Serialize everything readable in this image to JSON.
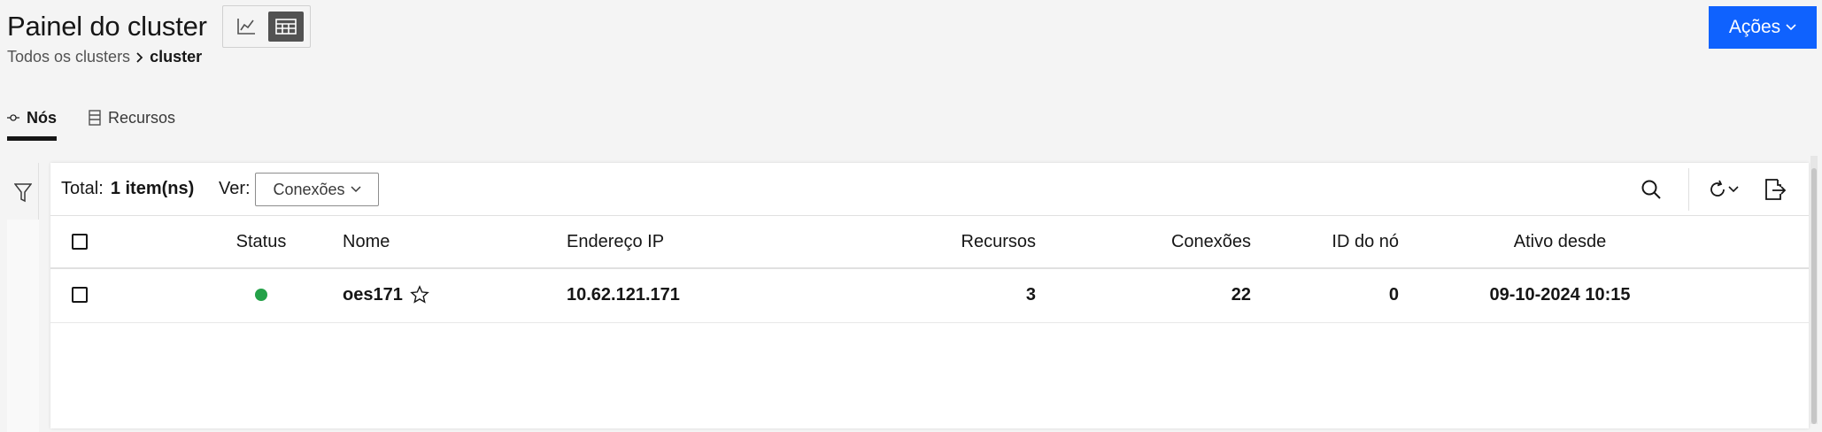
{
  "header": {
    "title": "Painel do cluster",
    "view_toggle": {
      "chart_icon": "line-chart-icon",
      "table_icon": "table-icon",
      "selected": "table"
    }
  },
  "breadcrumb": {
    "parent": "Todos os clusters",
    "current": "cluster"
  },
  "actions_button": {
    "label": "Ações"
  },
  "tabs": [
    {
      "label": "Nós",
      "icon": "node-icon",
      "active": true
    },
    {
      "label": "Recursos",
      "icon": "resource-icon",
      "active": false
    }
  ],
  "toolbar": {
    "total_label": "Total:",
    "total_value": "1 item(ns)",
    "view_label": "Ver:",
    "view_selected": "Conexões"
  },
  "table": {
    "columns": [
      "Status",
      "Nome",
      "Endereço IP",
      "Recursos",
      "Conexões",
      "ID do nó",
      "Ativo desde"
    ],
    "rows": [
      {
        "status": "online",
        "status_color": "#24a148",
        "name": "oes171",
        "ip": "10.62.121.171",
        "resources": "3",
        "connections": "22",
        "node_id": "0",
        "active_since": "09-10-2024 10:15"
      }
    ]
  },
  "colors": {
    "primary": "#0f62fe",
    "background": "#f4f4f4",
    "status_ok": "#24a148"
  }
}
